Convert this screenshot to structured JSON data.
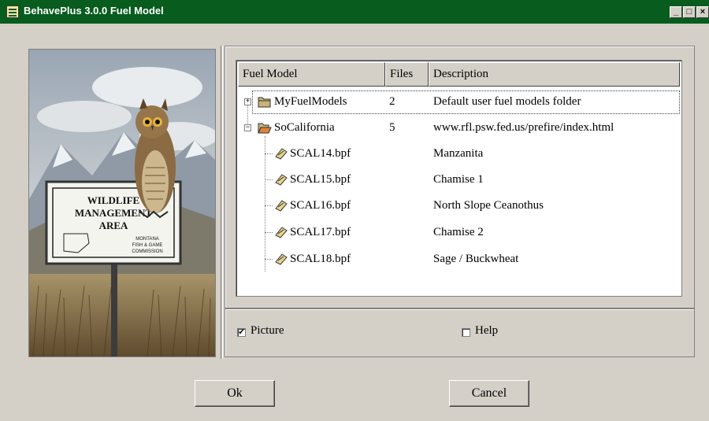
{
  "window": {
    "title": "BehavePlus 3.0.0 Fuel Model"
  },
  "picture": {
    "sign_lines": [
      "WILDLIFE",
      "MANAGEMENT",
      "AREA",
      "MONTANA",
      "FISH & GAME",
      "COMMISSION"
    ]
  },
  "table": {
    "columns": [
      "Fuel Model",
      "Files",
      "Description"
    ],
    "rows": [
      {
        "name": "MyFuelModels",
        "files": "2",
        "description": "Default user fuel models folder",
        "icon": "folder-closed-icon"
      },
      {
        "name": "SoCalifornia",
        "files": "5",
        "description": "www.rfl.psw.fed.us/prefire/index.html",
        "icon": "folder-open-icon"
      },
      {
        "name": "SCAL14.bpf",
        "files": "",
        "description": "Manzanita",
        "icon": "fuel-file-icon"
      },
      {
        "name": "SCAL15.bpf",
        "files": "",
        "description": "Chamise 1",
        "icon": "fuel-file-icon"
      },
      {
        "name": "SCAL16.bpf",
        "files": "",
        "description": "North Slope Ceanothus",
        "icon": "fuel-file-icon"
      },
      {
        "name": "SCAL17.bpf",
        "files": "",
        "description": "Chamise 2",
        "icon": "fuel-file-icon"
      },
      {
        "name": "SCAL18.bpf",
        "files": "",
        "description": "Sage / Buckwheat",
        "icon": "fuel-file-icon"
      }
    ]
  },
  "options": {
    "picture_label": "Picture",
    "picture_checked": "✔",
    "help_label": "Help",
    "help_checked": ""
  },
  "buttons": {
    "ok": "Ok",
    "cancel": "Cancel"
  },
  "colors": {
    "titlebar": "#075c1e",
    "dialog_bg": "#d4d0c8"
  }
}
